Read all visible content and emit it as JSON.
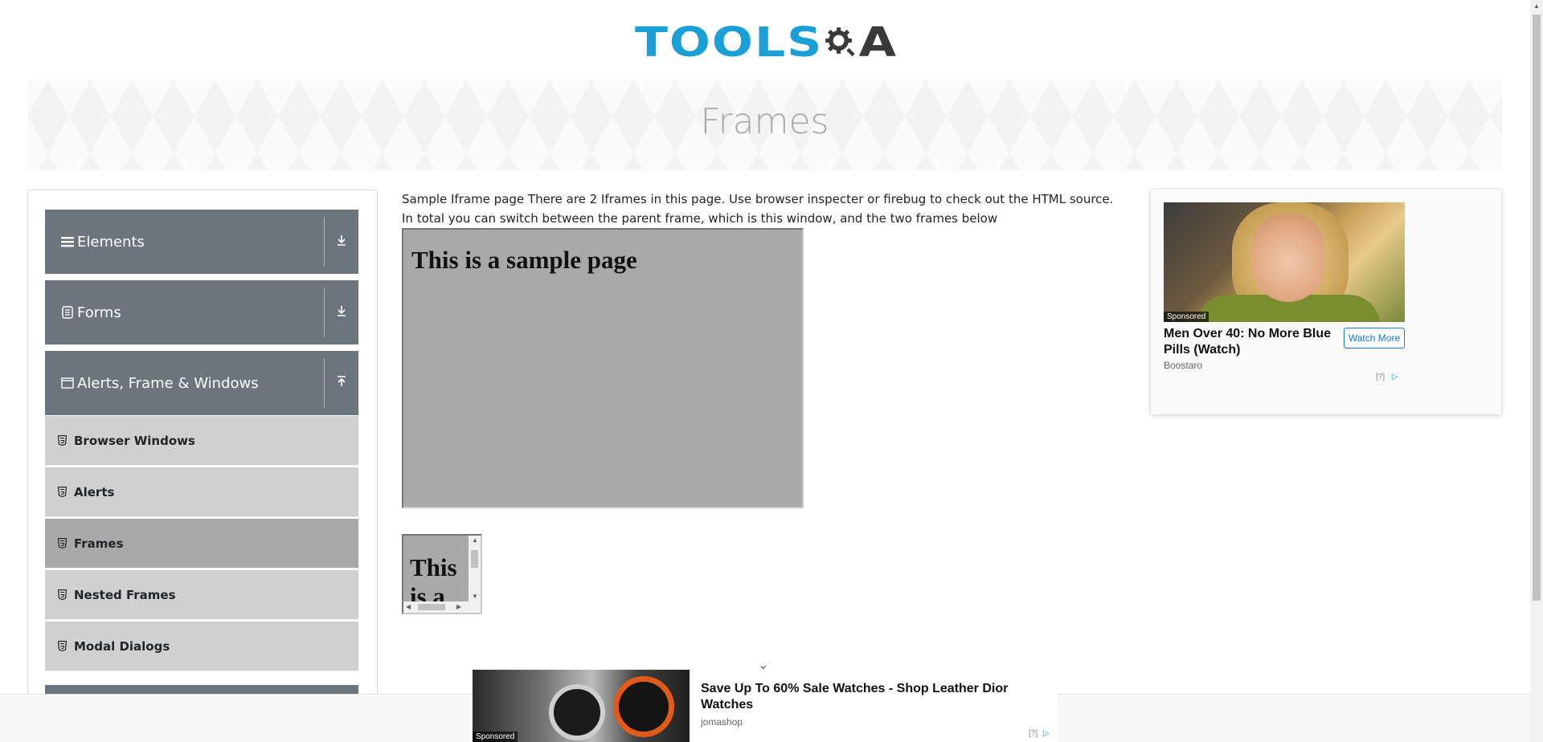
{
  "header": {
    "logo_primary": "TOOLS",
    "logo_secondary": "A"
  },
  "banner": {
    "title": "Frames"
  },
  "sidebar": {
    "groups": [
      {
        "label": "Elements",
        "icon": "hamburger-icon",
        "arrow": "download-arrow-icon"
      },
      {
        "label": "Forms",
        "icon": "form-icon",
        "arrow": "download-arrow-icon"
      },
      {
        "label": "Alerts, Frame & Windows",
        "icon": "window-icon",
        "arrow": "upload-arrow-icon"
      }
    ],
    "items": [
      {
        "label": "Browser Windows",
        "active": false
      },
      {
        "label": "Alerts",
        "active": false
      },
      {
        "label": "Frames",
        "active": true
      },
      {
        "label": "Nested Frames",
        "active": false
      },
      {
        "label": "Modal Dialogs",
        "active": false
      }
    ]
  },
  "main": {
    "description": "Sample Iframe page There are 2 Iframes in this page. Use browser inspecter or firebug to check out the HTML source. In total you can switch between the parent frame, which is this window, and the two frames below",
    "frame1_heading": "This is a sample page",
    "frame2_heading": "This is a"
  },
  "ad_right": {
    "title": "Men Over 40: No More Blue Pills (Watch)",
    "source": "Boostaro",
    "button": "Watch More",
    "sponsored": "Sponsored",
    "info": "[?]"
  },
  "ad_bottom": {
    "title": "Save Up To 60% Sale Watches - Shop Leather Dior Watches",
    "source": "jomashop",
    "sponsored": "Sponsored",
    "info": "[?]"
  },
  "colors": {
    "brand_blue": "#1a9fd6",
    "sidebar_header": "#6c757d",
    "menu_item": "#d0d0d0",
    "menu_item_active": "#a9a9a9",
    "frame_bg": "#a9a9a9"
  }
}
